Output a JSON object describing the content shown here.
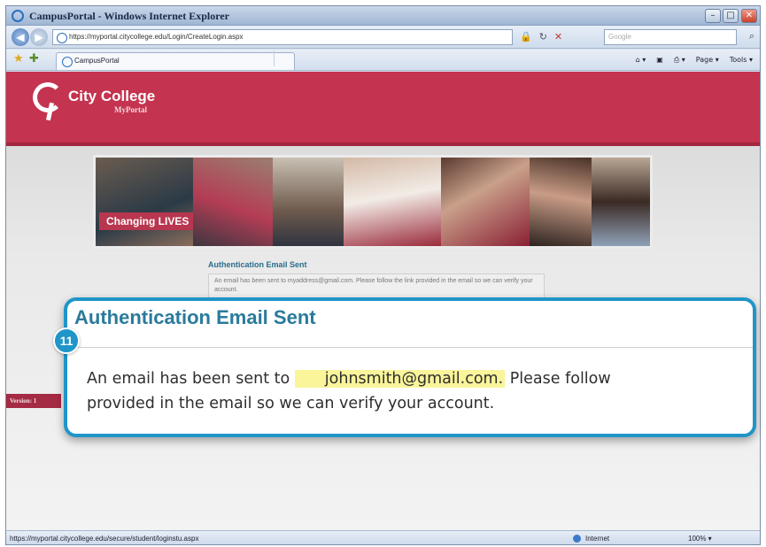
{
  "window": {
    "title": "CampusPortal - Windows Internet Explorer",
    "min_glyph": "–",
    "max_glyph": "□",
    "close_glyph": "✕"
  },
  "nav": {
    "back_glyph": "◀",
    "forward_glyph": "▶",
    "url": "https://myportal.citycollege.edu/Login/CreateLogin.aspx",
    "lock_glyph": "🔒",
    "refresh_glyph": "↻",
    "stop_glyph": "✕",
    "search_placeholder": "Google",
    "search_glyph": "⌕"
  },
  "tabs": {
    "active_label": "CampusPortal",
    "favorites_glyph": "★",
    "add_favorite_glyph": "✚"
  },
  "command_bar": {
    "home": "⌂ ▾",
    "feeds": "▣",
    "print": "⎙ ▾",
    "page": "Page ▾",
    "tools": "Tools ▾"
  },
  "header": {
    "college_name": "City College",
    "portal_name": "MyPortal"
  },
  "banner": {
    "tagline": "Changing LIVES"
  },
  "page": {
    "heading": "Authentication Email Sent",
    "message": "An email has been sent to myaddress@gmail.com. Please follow the link provided in the email so we can verify your account.",
    "version_label": "Version: 1"
  },
  "callout": {
    "step_number": "11",
    "title": "Authentication Email Sent",
    "line1_prefix": "An email has been sent to",
    "email": "johnsmith@gmail.com.",
    "line1_suffix": "Please follow",
    "line2": "provided in the email so we can verify your account.",
    "accent_color": "#1f95c9",
    "highlight_color": "#faf59a"
  },
  "status": {
    "url": "https://myportal.citycollege.edu/secure/student/loginstu.aspx",
    "zone": "Internet",
    "zoom": "100% ▾"
  },
  "colors": {
    "brand": "#c4334f"
  }
}
